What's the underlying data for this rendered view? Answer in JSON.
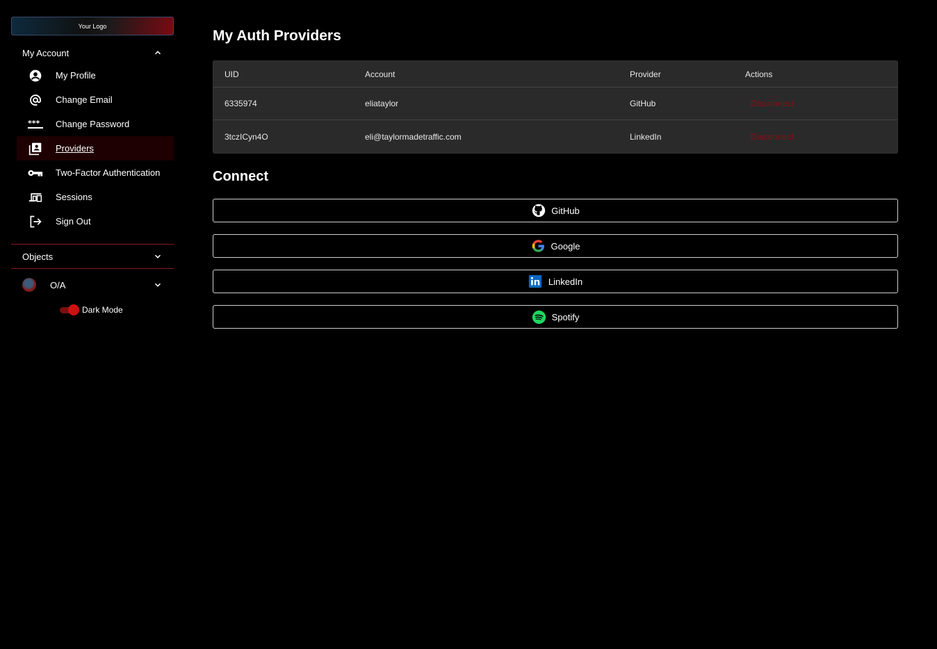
{
  "sidebar": {
    "logo": "Your Logo",
    "account_section": "My Account",
    "items": [
      {
        "label": "My Profile",
        "icon": "account-circle-icon"
      },
      {
        "label": "Change Email",
        "icon": "at-sign-icon"
      },
      {
        "label": "Change Password",
        "icon": "password-dots-icon"
      },
      {
        "label": "Providers",
        "icon": "contacts-stack-icon",
        "active": true
      },
      {
        "label": "Two-Factor Authentication",
        "icon": "key-icon"
      },
      {
        "label": "Sessions",
        "icon": "devices-icon"
      },
      {
        "label": "Sign Out",
        "icon": "logout-icon"
      }
    ],
    "objects_section": "Objects",
    "user_label": "O/A",
    "dark_mode_label": "Dark Mode",
    "dark_mode_on": true,
    "accent_color": "#cc1111"
  },
  "main": {
    "title": "My Auth Providers",
    "table": {
      "headers": [
        "UID",
        "Account",
        "Provider",
        "Actions"
      ],
      "rows": [
        {
          "uid": "6335974",
          "account": "eliataylor",
          "provider": "GitHub",
          "action": "Disconnect"
        },
        {
          "uid": "3tczICyn4O",
          "account": "eli@taylormadetraffic.com",
          "provider": "LinkedIn",
          "action": "Disconnect"
        }
      ]
    },
    "connect_title": "Connect",
    "connect_buttons": [
      {
        "label": "GitHub",
        "icon": "github-icon"
      },
      {
        "label": "Google",
        "icon": "google-icon"
      },
      {
        "label": "LinkedIn",
        "icon": "linkedin-icon"
      },
      {
        "label": "Spotify",
        "icon": "spotify-icon"
      }
    ]
  }
}
